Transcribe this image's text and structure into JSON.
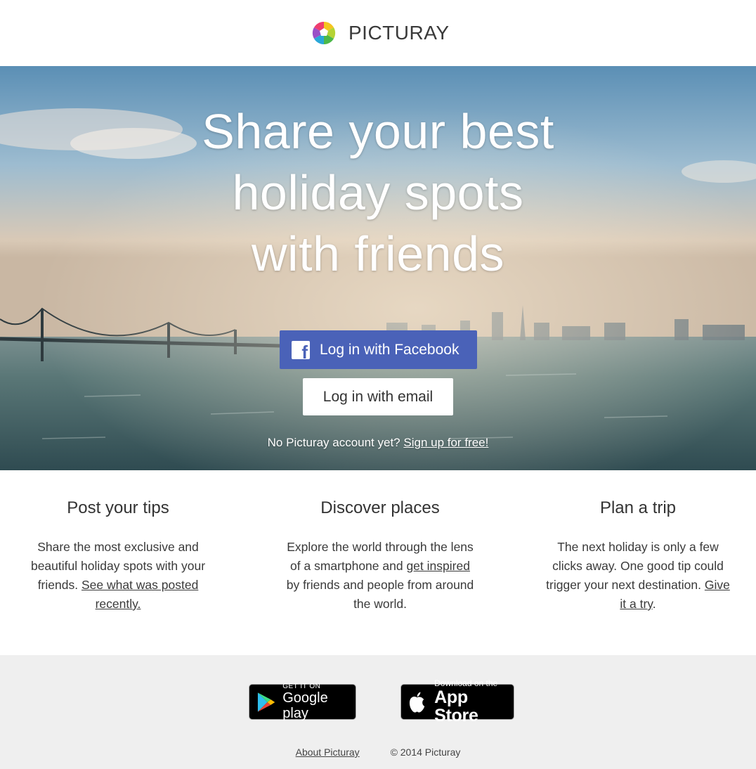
{
  "header": {
    "brand": "PICTURAY"
  },
  "hero": {
    "title_line1": "Share your best",
    "title_line2": "holiday spots",
    "title_line3": "with friends",
    "facebook_button": "Log in with Facebook",
    "email_button": "Log in with email",
    "signup_prompt": "No Picturay account yet?",
    "signup_link": "Sign up for free!"
  },
  "features": [
    {
      "title": "Post your tips",
      "text": "Share the most exclusive and beautiful holiday spots with your friends.",
      "link": "See what was posted recently."
    },
    {
      "title": "Discover places",
      "text_before": "Explore the world through the lens of a smartphone and",
      "link": "get inspired",
      "text_after": "by friends and people from around the world."
    },
    {
      "title": "Plan a trip",
      "text": "The next holiday is only a few clicks away. One good tip could trigger your next destination.",
      "link": "Give it a try",
      "text_after": "."
    }
  ],
  "footer": {
    "google_play_small": "GET IT ON",
    "google_play_big": "Google play",
    "app_store_small": "Download on the",
    "app_store_big": "App Store",
    "about_link": "About Picturay",
    "copyright": "© 2014 Picturay"
  },
  "colors": {
    "facebook_blue": "#4a62b8",
    "footer_bg": "#efefef"
  }
}
